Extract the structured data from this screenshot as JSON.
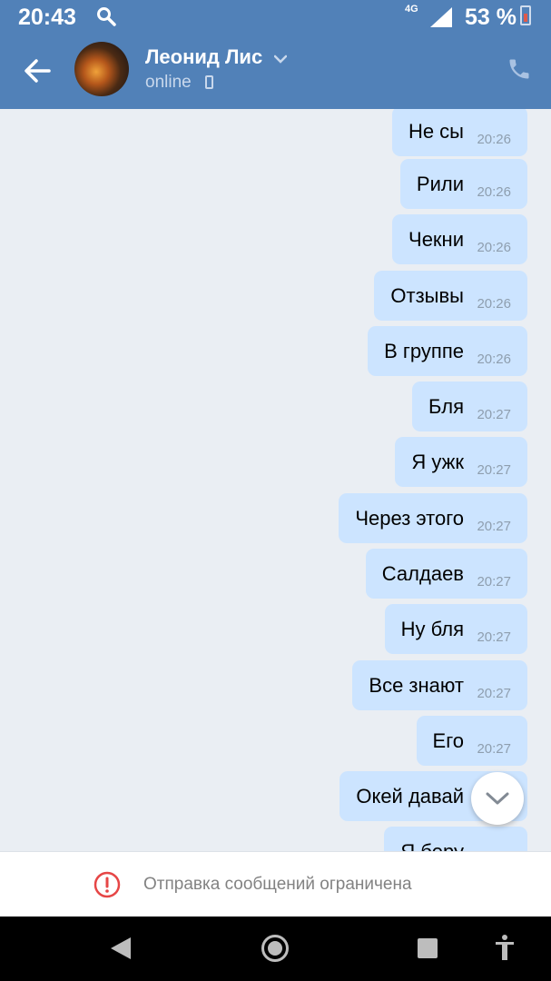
{
  "status_bar": {
    "time": "20:43",
    "network": "4G",
    "battery": "53 %"
  },
  "header": {
    "name": "Леонид Лис",
    "status": "online"
  },
  "messages": [
    {
      "text": "Не сы",
      "time": "20:26"
    },
    {
      "text": "Рили",
      "time": "20:26"
    },
    {
      "text": "Чекни",
      "time": "20:26"
    },
    {
      "text": "Отзывы",
      "time": "20:26"
    },
    {
      "text": "В группе",
      "time": "20:26"
    },
    {
      "text": "Бля",
      "time": "20:27"
    },
    {
      "text": "Я ужк",
      "time": "20:27"
    },
    {
      "text": "Через этого",
      "time": "20:27"
    },
    {
      "text": "Салдаев",
      "time": "20:27"
    },
    {
      "text": "Ну бля",
      "time": "20:27"
    },
    {
      "text": "Все знают",
      "time": "20:27"
    },
    {
      "text": "Его",
      "time": "20:27"
    },
    {
      "text": "Окей давай",
      "time": ""
    },
    {
      "text": "Я беру",
      "time": ""
    }
  ],
  "restriction": {
    "text": "Отправка сообщений ограничена"
  },
  "colors": {
    "header": "#5181b8",
    "bubble": "#cce4ff",
    "background": "#eaeef3",
    "alert": "#e64646"
  }
}
